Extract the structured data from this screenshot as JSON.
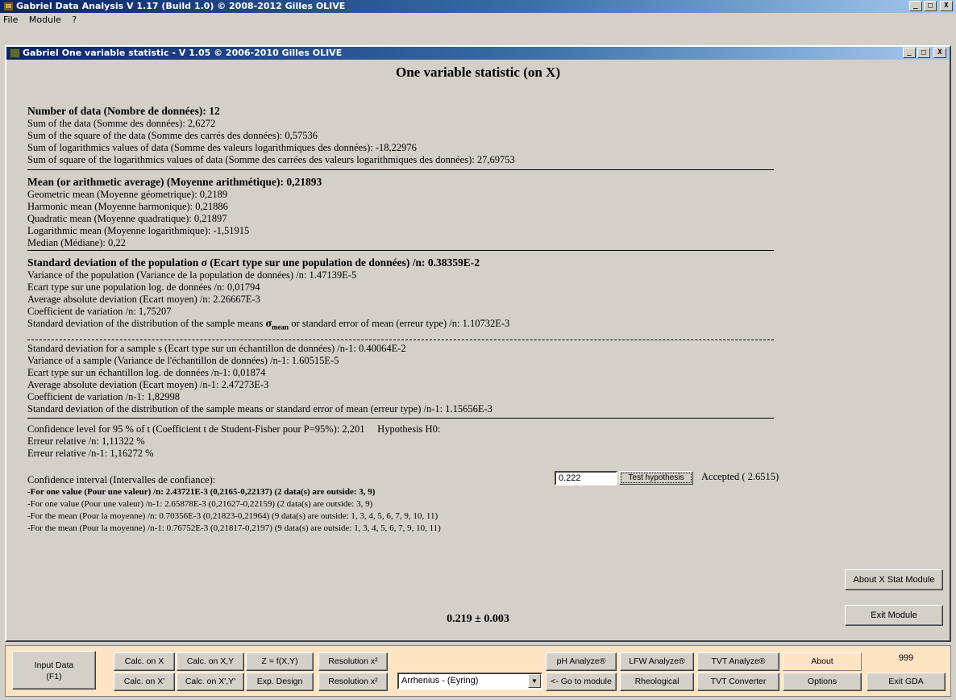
{
  "app": {
    "title": "Gabriel Data Analysis V 1.17 (Build 1.0) © 2008-2012 Gilles OLIVE",
    "menu": [
      "File",
      "Module",
      "?"
    ],
    "win_buttons": {
      "minimize": "_",
      "maximize": "□",
      "close": "X"
    }
  },
  "module": {
    "title": "Gabriel One variable statistic -  V 1.05 © 2006-2010 Gilles OLIVE",
    "heading": "One variable statistic (on X)"
  },
  "stats": {
    "block1": [
      "Number of data (Nombre de données): 12",
      "Sum of the data (Somme des données): 2,6272",
      "Sum of the square of the data (Somme des carrés des données): 0,57536",
      "Sum of logarithmics values of data (Somme des valeurs logarithmiques des données): -18,22976",
      "Sum of square of the logarithmics values of data (Somme des carrées des valeurs logarithmiques des données): 27,69753"
    ],
    "block2": [
      "Mean (or arithmetic average) (Moyenne arithmétique): 0,21893",
      "Geometric mean (Moyenne géometrique): 0,2189",
      "Harmonic mean (Moyenne harmonique): 0,21886",
      "Quadratic mean (Moyenne quadratique): 0,21897",
      "Logarithmic mean (Moyenne logarithmique): -1,51915",
      "Median (Médiane): 0,22"
    ],
    "block3": [
      "Standard deviation of the population σ (Ecart type sur une population de données) /n: 0.38359E-2",
      "Variance of the population (Variance de la population de données) /n:  1.47139E-5",
      "Ecart type sur une population log. de données /n: 0,01794",
      "Average absolute deviation (Ecart moyen) /n:  2.26667E-3",
      "Coefficient de variation /n: 1,75207"
    ],
    "sem_prefix": "Standard deviation of the distribution of the sample means ",
    "sem_sigma": "σ",
    "sem_sub": "mean",
    "sem_suffix": " or standard error of mean (erreur type) /n:  1.10732E-3",
    "block4": [
      "Standard deviation for a sample s (Ecart type sur un échantillon de données) /n-1: 0.40064E-2",
      "Variance of a sample (Variance de l'échantillon de données) /n-1:  1.60515E-5",
      "Ecart type sur un échantillon log. de données /n-1: 0,01874",
      "Average absolute deviation (Ecart moyen) /n-1:  2.47273E-3",
      "Coefficient de variation /n-1: 1,82998",
      "Standard deviation of the distribution of the sample means or standard error of mean (erreur type) /n-1:  1.15656E-3"
    ],
    "confidence_level": "Confidence level for 95 % of t (Coefficient t de Student-Fisher pour P=95%): 2,201",
    "hypothesis_label": "Hypothesis H0:",
    "hypothesis_value": "0.222",
    "test_button": "Test hypothesis",
    "hypothesis_result": "Accepted ( 2.6515)",
    "relative_errors": [
      "Erreur relative /n: 1,11322 %",
      "Erreur relative /n-1: 1,16272 %"
    ],
    "ci_title": "Confidence interval (Intervalles de confiance):",
    "ci_lines": [
      "-For one value (Pour une valeur) /n:  2.43721E-3 (0,2165-0,22137)  (2 data(s) are outside: 3, 9)",
      "-For one value (Pour une valeur) /n-1:  2.65878E-3  (0,21627-0,22159)  (2 data(s) are outside: 3, 9)",
      "-For the mean (Pour la moyenne) /n: 0.70356E-3  (0,21823-0,21964)  (9 data(s) are outside: 1, 3, 4, 5, 6, 7, 9, 10, 11)",
      "-For the mean (Pour la moyenne) /n-1: 0.76752E-3  (0,21817-0,2197)  (9 data(s) are outside: 1, 3, 4, 5, 6, 7, 9, 10, 11)"
    ],
    "result": "0.219 ± 0.003"
  },
  "side_buttons": {
    "about": "About X Stat Module",
    "exit": "Exit Module"
  },
  "toolbar": {
    "input_data": "Input Data\n(F1)",
    "calc_x": "Calc. on X",
    "calc_x2": "Calc. on X'",
    "calc_xy": "Calc. on X,Y",
    "calc_xy2": "Calc. on X',Y'",
    "zfxy": "Z = f(X,Y)",
    "exp_design": "Exp. Design",
    "resolution1": "Resolution x²",
    "resolution2": "Resolution x²",
    "combo_value": "Arrhenius - (Eyring)",
    "ph": "pH Analyze®",
    "goto": "<- Go to module",
    "lfw": "LFW Analyze®",
    "rheological": "Rheological",
    "tvt": "TVT Analyze®",
    "tvt_conv": "TVT Converter",
    "about": "About",
    "options": "Options",
    "counter": "999",
    "exit_gda": "Exit GDA"
  }
}
